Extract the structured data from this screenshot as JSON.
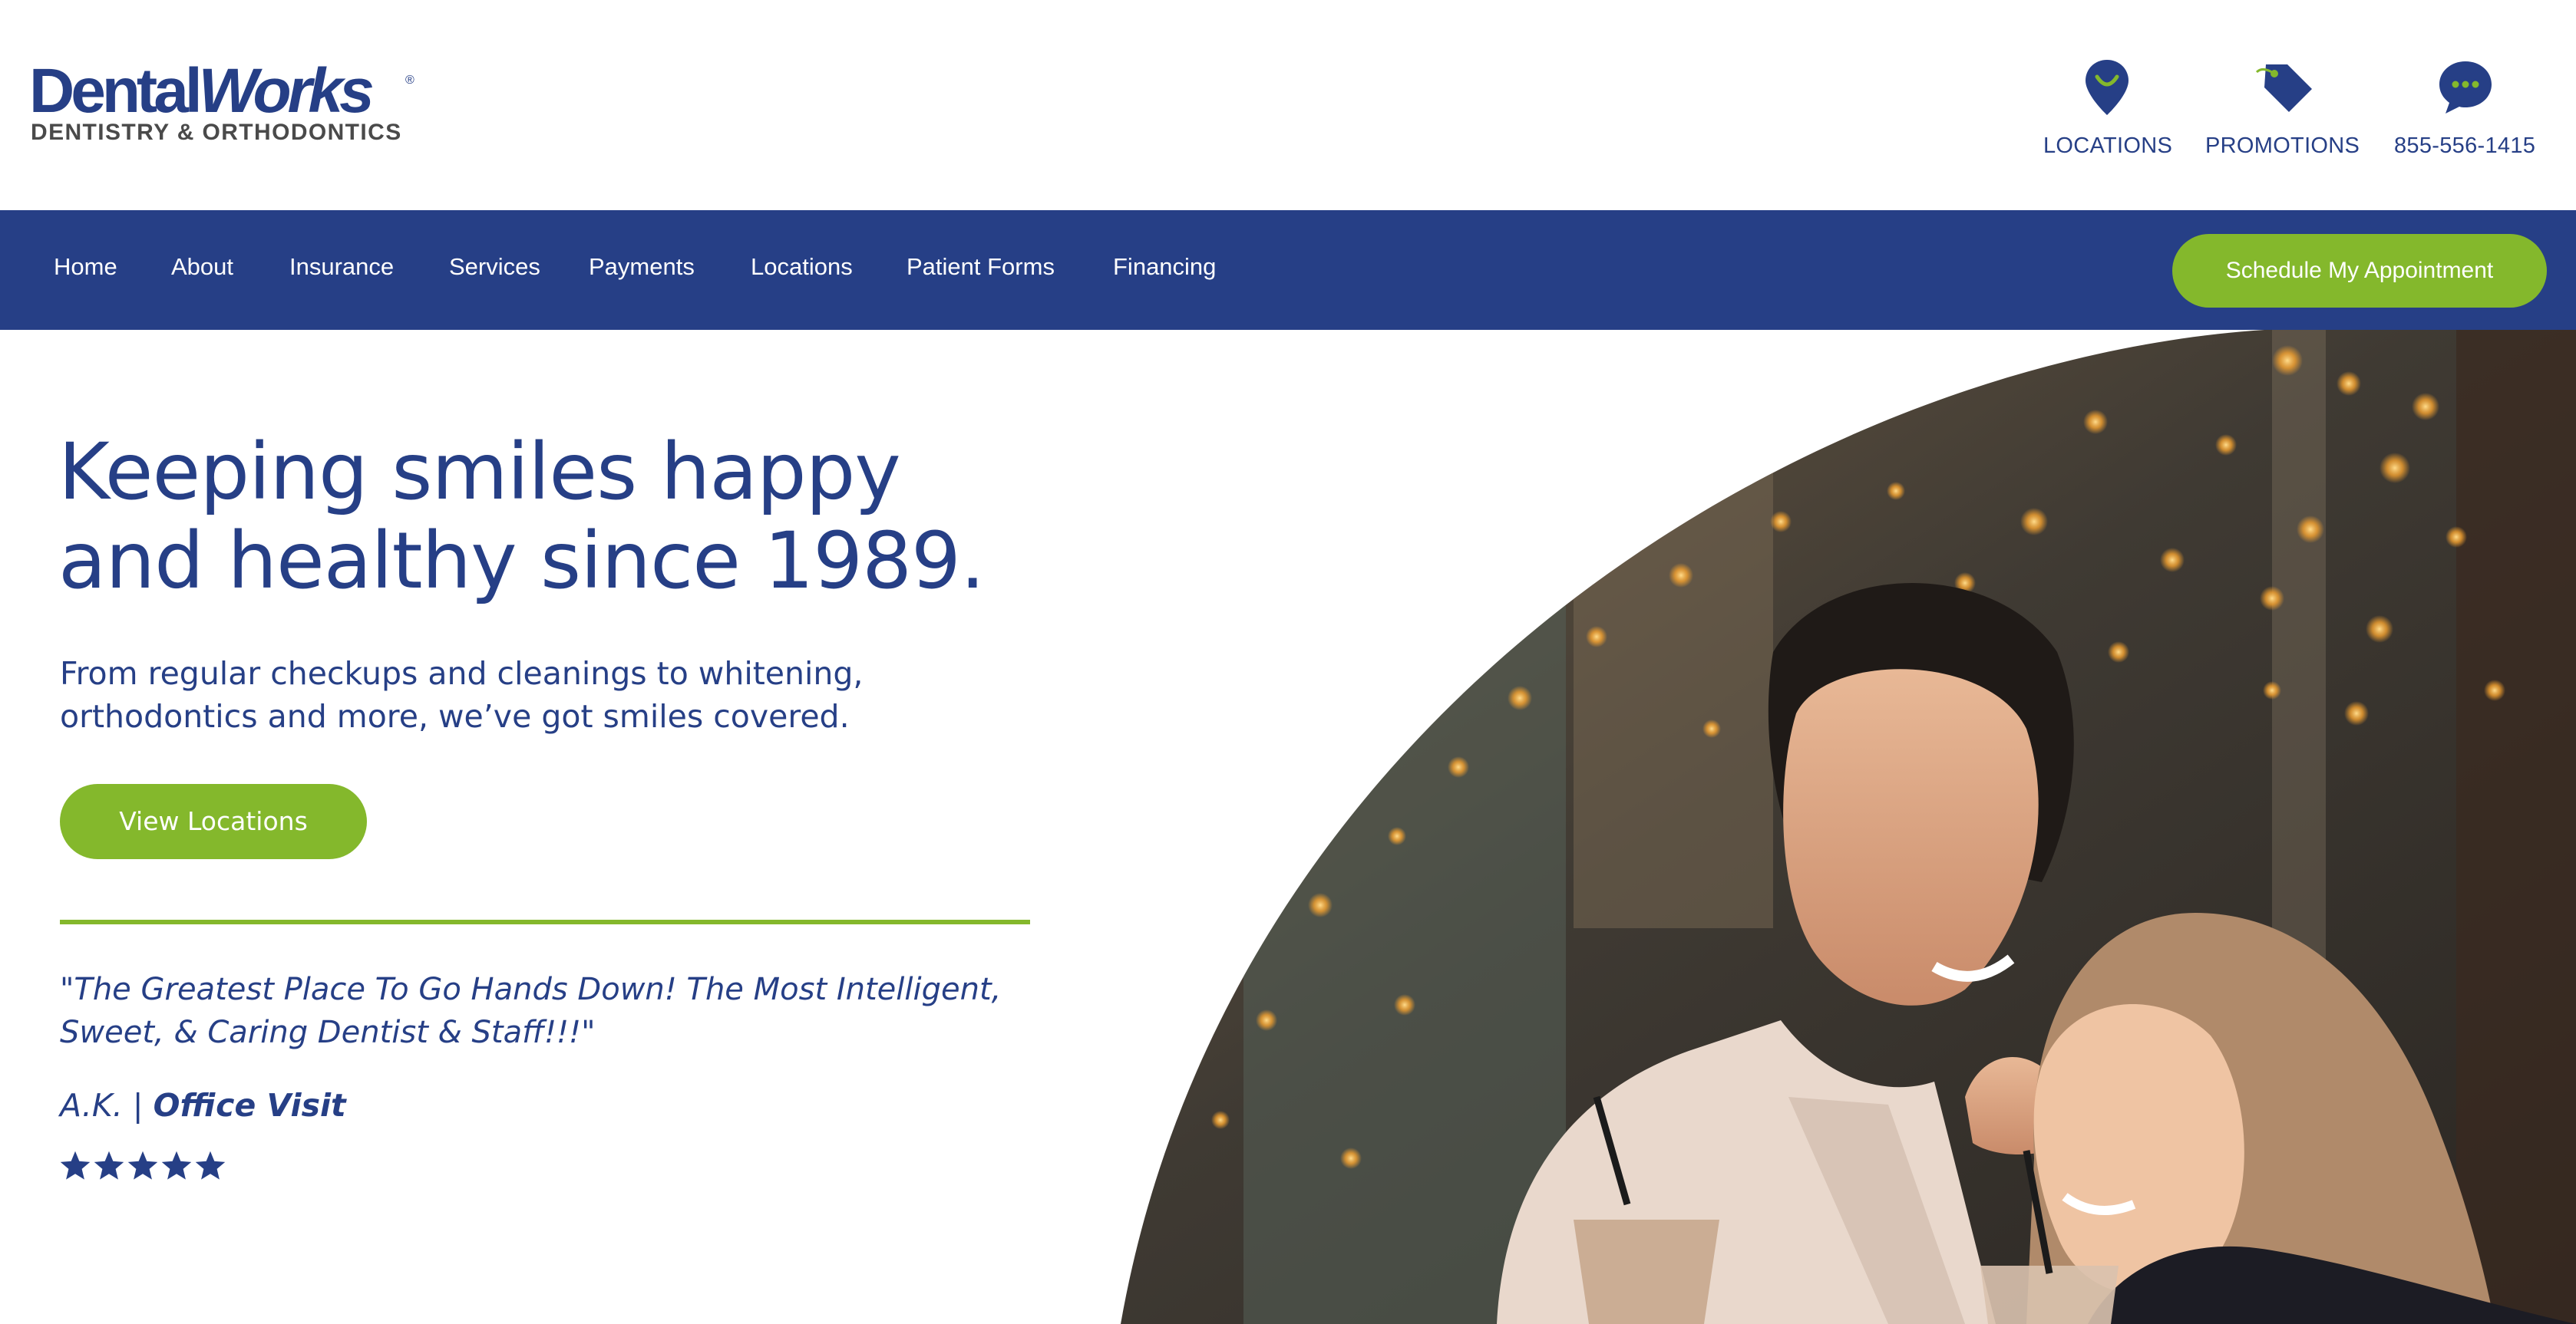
{
  "brand": {
    "logo_main_regular": "Dental",
    "logo_main_italic": "Works",
    "logo_registered": "®",
    "logo_sub": "DENTISTRY & ORTHODONTICS",
    "primary_color": "#263f86",
    "accent_color": "#84b82c"
  },
  "utility": {
    "locations_label": "LOCATIONS",
    "promotions_label": "PROMOTIONS",
    "phone_label": "855-556-1415"
  },
  "nav": {
    "items": [
      "Home",
      "About",
      "Insurance",
      "Services",
      "Payments",
      "Locations",
      "Patient Forms",
      "Financing"
    ],
    "cta_label": "Schedule My Appointment"
  },
  "hero": {
    "headline_line1": "Keeping smiles happy",
    "headline_line2": "and healthy since 1989.",
    "subtext_line1": "From regular checkups and cleanings to whitening,",
    "subtext_line2": "orthodontics and more, we’ve got smiles covered.",
    "button_label": "View Locations",
    "quote_line1": "\"The Greatest Place To Go Hands Down! The Most Intelligent,",
    "quote_line2": "Sweet, & Caring Dentist & Staff!!!\"",
    "reviewer": "A.K. |",
    "review_type": "Office Visit",
    "rating": 5,
    "rating_max": 5
  },
  "icons": {
    "locations": "map-pin-icon",
    "promotions": "tag-icon",
    "phone": "chat-bubble-icon",
    "rating": "star-icon"
  }
}
